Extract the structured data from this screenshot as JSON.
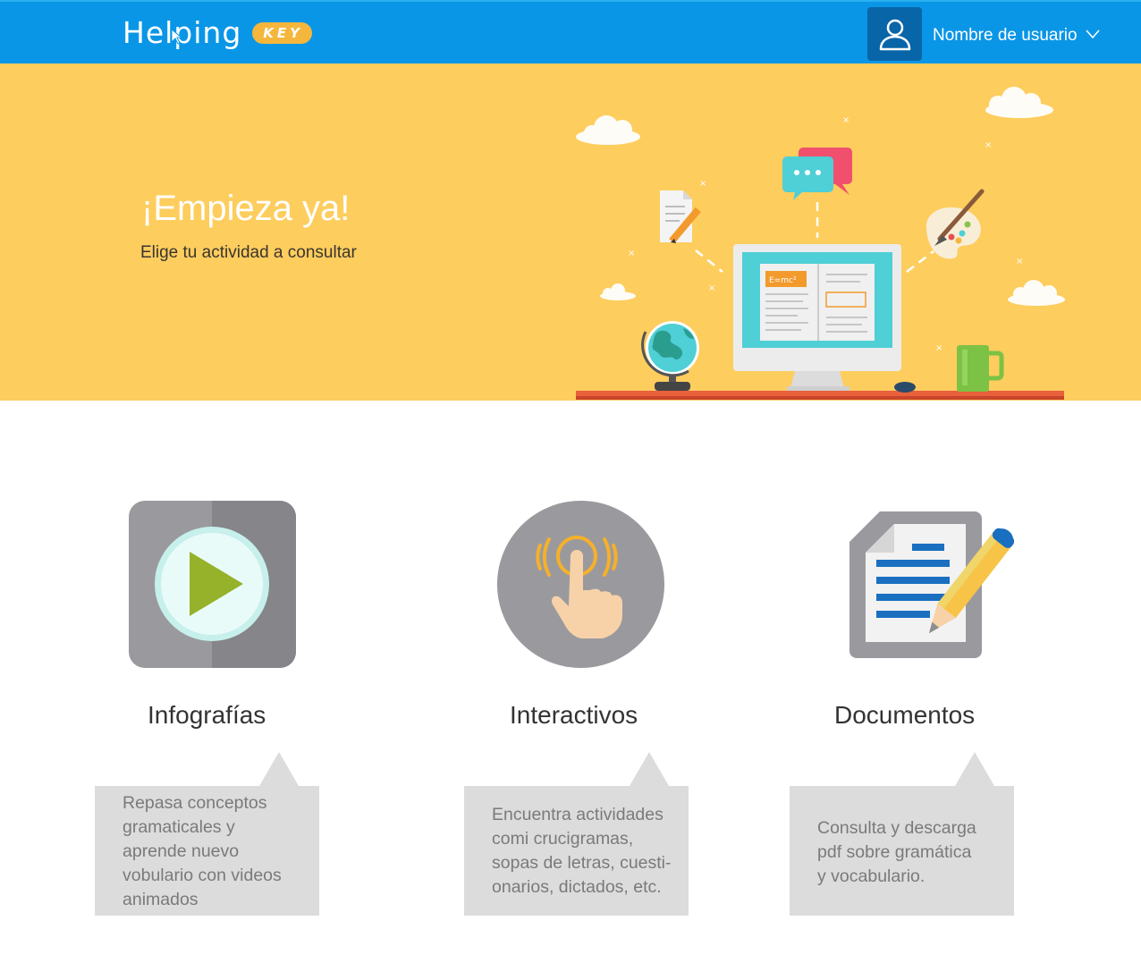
{
  "header": {
    "logo_text": "Helping",
    "logo_badge": "KEY",
    "user_icon": "user-icon",
    "user_name": "Nombre de usuario",
    "user_menu_icon": "chevron-down-icon",
    "colors": {
      "bar": "#0a96e6",
      "avatar_bg": "#0865a8",
      "badge": "#f5b63c"
    }
  },
  "hero": {
    "title": "¡Empieza ya!",
    "subtitle": "Elige tu actividad a consultar",
    "illustration": {
      "formula": "E=mc²"
    },
    "colors": {
      "background": "#fdcd5e"
    }
  },
  "activities": [
    {
      "icon": "play-video-icon",
      "title": "Infografías",
      "description_lines": [
        "Repasa conceptos",
        "gramaticales y",
        "aprende nuevo",
        "vobulario con videos",
        "animados"
      ]
    },
    {
      "icon": "touch-gesture-icon",
      "title": "Interactivos",
      "description_lines": [
        "Encuentra actividades",
        "comi crucigramas,",
        "sopas de letras, cuesti-",
        "onarios, dictados, etc."
      ]
    },
    {
      "icon": "document-edit-icon",
      "title": "Documentos",
      "description_lines": [
        "Consulta y descarga",
        "pdf sobre gramática",
        "y vocabulario."
      ]
    }
  ]
}
